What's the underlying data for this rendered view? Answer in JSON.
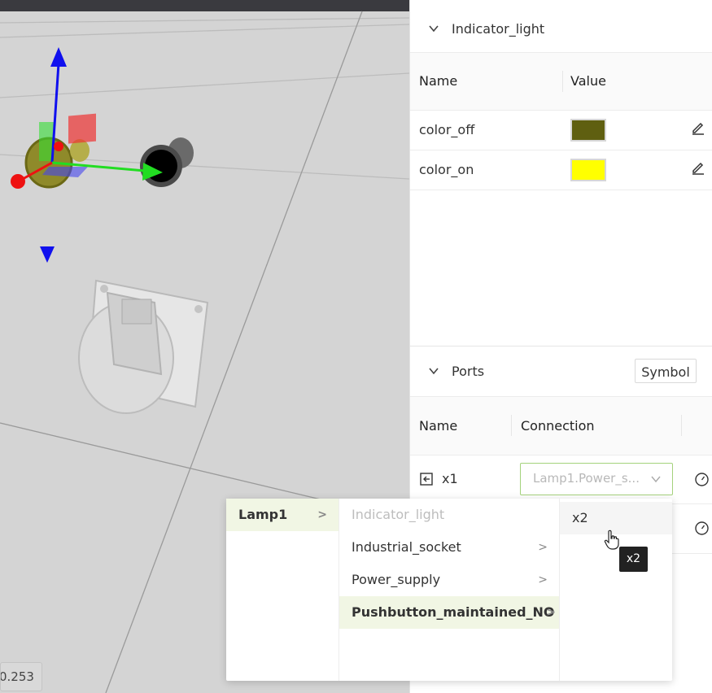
{
  "viewport": {
    "coordinate_readout": "0.253"
  },
  "properties": {
    "title": "Indicator_light",
    "columns": {
      "name": "Name",
      "value": "Value"
    },
    "rows": [
      {
        "name": "color_off",
        "color": "#5f5f10"
      },
      {
        "name": "color_on",
        "color": "#ffff00"
      }
    ]
  },
  "ports": {
    "title": "Ports",
    "symbol_button": "Symbol",
    "columns": {
      "name": "Name",
      "connection": "Connection"
    },
    "rows": [
      {
        "name": "x1",
        "connection": "Lamp1.Power_s..."
      }
    ]
  },
  "cascader": {
    "level1": [
      {
        "label": "Lamp1",
        "active": true
      }
    ],
    "level2": [
      {
        "label": "Indicator_light",
        "disabled": true
      },
      {
        "label": "Industrial_socket"
      },
      {
        "label": "Power_supply"
      },
      {
        "label": "Pushbutton_maintained_NO",
        "active": true
      }
    ],
    "level3": [
      {
        "label": "x2",
        "hover": true
      }
    ],
    "tooltip": "x2"
  },
  "colors": {
    "accent_border": "#a4d27c",
    "active_bg": "#f1f6e4",
    "axis_x": "#22dd22",
    "axis_y": "#1010ee",
    "axis_z": "#ee1111"
  }
}
